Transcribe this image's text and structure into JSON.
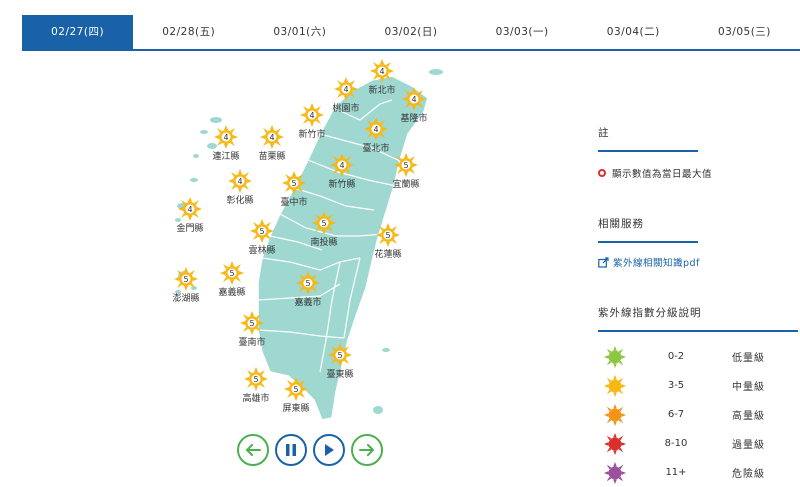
{
  "tabs": [
    {
      "label": "02/27(四)",
      "active": true
    },
    {
      "label": "02/28(五)",
      "active": false
    },
    {
      "label": "03/01(六)",
      "active": false
    },
    {
      "label": "03/02(日)",
      "active": false
    },
    {
      "label": "03/03(一)",
      "active": false
    },
    {
      "label": "03/04(二)",
      "active": false
    },
    {
      "label": "03/05(三)",
      "active": false
    }
  ],
  "cities": [
    {
      "name": "新北市",
      "value": "4"
    },
    {
      "name": "桃園市",
      "value": "4"
    },
    {
      "name": "基隆市",
      "value": "4"
    },
    {
      "name": "新竹市",
      "value": "4"
    },
    {
      "name": "臺北市",
      "value": "4"
    },
    {
      "name": "連江縣",
      "value": "4"
    },
    {
      "name": "苗栗縣",
      "value": "4"
    },
    {
      "name": "新竹縣",
      "value": "4"
    },
    {
      "name": "宜蘭縣",
      "value": "5"
    },
    {
      "name": "彰化縣",
      "value": "4"
    },
    {
      "name": "臺中市",
      "value": "5"
    },
    {
      "name": "金門縣",
      "value": "4"
    },
    {
      "name": "南投縣",
      "value": "5"
    },
    {
      "name": "雲林縣",
      "value": "5"
    },
    {
      "name": "花蓮縣",
      "value": "5"
    },
    {
      "name": "澎湖縣",
      "value": "5"
    },
    {
      "name": "嘉義縣",
      "value": "5"
    },
    {
      "name": "嘉義市",
      "value": "5"
    },
    {
      "name": "臺南市",
      "value": "5"
    },
    {
      "name": "臺東縣",
      "value": "5"
    },
    {
      "name": "高雄市",
      "value": "5"
    },
    {
      "name": "屏東縣",
      "value": "5"
    }
  ],
  "panel": {
    "note_title": "註",
    "note_text": "顯示數值為當日最大值",
    "services_title": "相關服務",
    "services_link": "紫外線相關知識pdf",
    "legend_title": "紫外線指數分級說明",
    "legend": [
      {
        "range": "0-2",
        "level": "低量級",
        "color": "#8dc63f"
      },
      {
        "range": "3-5",
        "level": "中量級",
        "color": "#f7b815"
      },
      {
        "range": "6-7",
        "level": "高量級",
        "color": "#f39419"
      },
      {
        "range": "8-10",
        "level": "過量級",
        "color": "#d9302c"
      },
      {
        "range": "11+",
        "level": "危險級",
        "color": "#9b4f9e"
      }
    ]
  },
  "colors": {
    "accent": "#1a62a8",
    "land": "#9fd8d0",
    "moderate_sun": "#f7b815",
    "control_green": "#4caf50"
  },
  "controls": [
    "prev-day",
    "pause",
    "play",
    "next-day"
  ]
}
